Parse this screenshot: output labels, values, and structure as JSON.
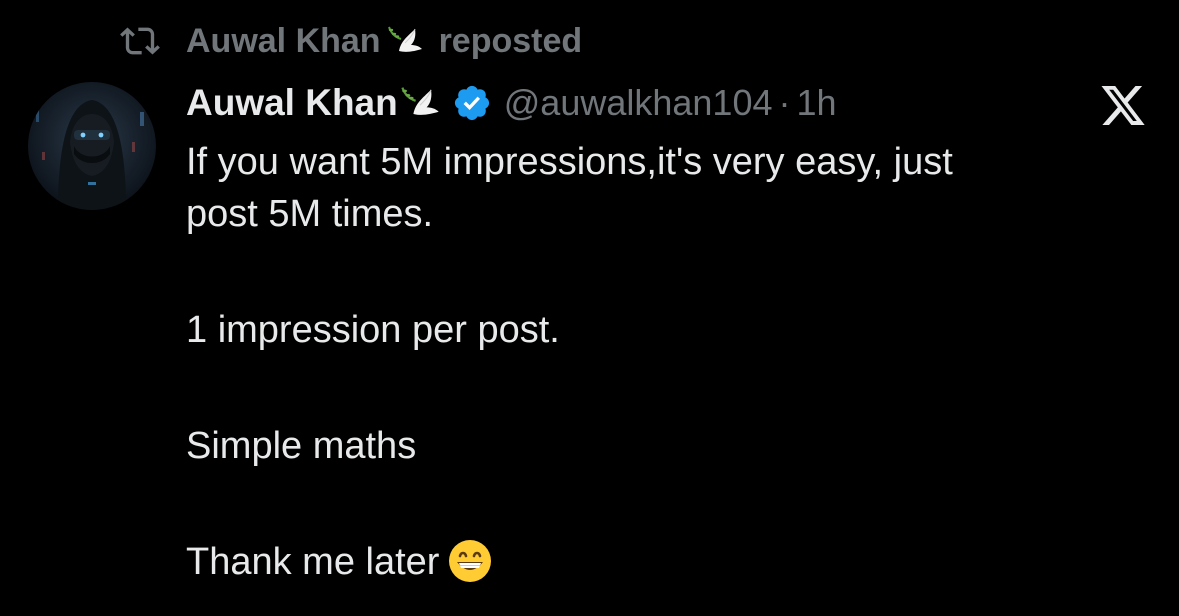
{
  "repost": {
    "icon": "repost-icon",
    "name": "Auwal Khan",
    "emoji": "dove-icon",
    "label": "reposted"
  },
  "author": {
    "avatar": "avatar",
    "name": "Auwal Khan",
    "emoji": "dove-icon",
    "verified_icon": "verified-badge-icon",
    "handle": "@auwalkhan104",
    "separator": "·",
    "time": "1h"
  },
  "platform_icon": "x-logo-icon",
  "tweet": {
    "line1": "If you want 5M impressions,it's very easy,  just",
    "line2": "post 5M times.",
    "para2": "1 impression per post.",
    "para3": "Simple maths",
    "para4": "Thank me later",
    "para4_emoji": "grinning-face-icon"
  },
  "colors": {
    "background": "#000000",
    "text": "#e7e9ea",
    "muted": "#71767b",
    "verified": "#1d9bf0"
  }
}
